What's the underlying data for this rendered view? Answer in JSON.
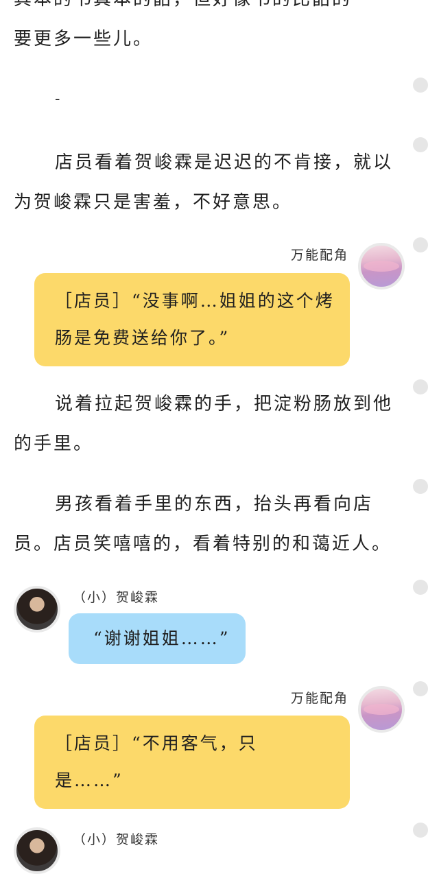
{
  "paragraphs": {
    "p0_line1": "其本的书真本的韶，但好像书的比韶的",
    "p0_line2": "要更多一些儿。",
    "dash": "-",
    "p1": "店员看着贺峻霖是迟迟的不肯接，就以为贺峻霖只是害羞，不好意思。",
    "p2": "说着拉起贺峻霖的手，把淀粉肠放到他的手里。",
    "p3": "男孩看着手里的东西，抬头再看向店员。店员笑嘻嘻的，看着特别的和蔼近人。"
  },
  "messages": {
    "m1": {
      "sender": "万能配角",
      "text": "［店员］“没事啊…姐姐的这个烤肠是免费送给你了。”"
    },
    "m2": {
      "sender": "（小）贺峻霖",
      "text": "“谢谢姐姐……”"
    },
    "m3": {
      "sender": "万能配角",
      "text": "［店员］“不用客气，只是……”"
    },
    "m4": {
      "sender": "（小）贺峻霖"
    }
  }
}
